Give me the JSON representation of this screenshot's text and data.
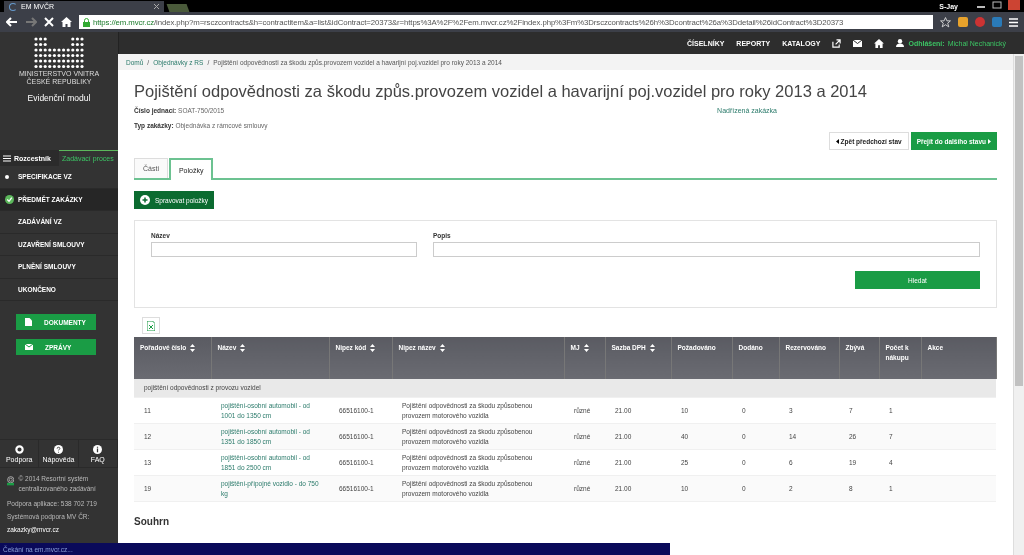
{
  "browser": {
    "tab_title": "EM MVČR",
    "user": "S-Jay",
    "url_host": "https://em.mvcr.cz",
    "url_path": "/index.php?m=rsczcontracts&h=contractitem&a=list&idContract=20373&r=https%3A%2F%2Fem.mvcr.cz%2Findex.php%3Fm%3Drsczcontracts%26h%3Dcontract%26a%3Ddetail%26idContract%3D20373",
    "status": "Čekání na em.mvcr.cz..."
  },
  "topnav": {
    "items": [
      "ČÍSELNÍKY",
      "REPORTY",
      "KATALOGY"
    ],
    "logout_label": "Odhlášení:",
    "user": "Michal Nechanický"
  },
  "sidebar": {
    "logo_lines": [
      "MINISTERSTVO VNITRA",
      "ČESKÉ REPUBLIKY"
    ],
    "module": "Evidenční modul",
    "tabs": [
      {
        "label": "Rozcestník",
        "selected": false
      },
      {
        "label": "Zadávací proces",
        "selected": true
      }
    ],
    "steps": [
      {
        "label": "SPECIFIKACE VZ",
        "visited": true,
        "selected": false
      },
      {
        "label": "PŘEDMĚT ZAKÁZKY",
        "visited": false,
        "selected": true
      },
      {
        "label": "ZADÁVÁNÍ VZ",
        "visited": false,
        "selected": false
      },
      {
        "label": "UZAVŘENÍ SMLOUVY",
        "visited": false,
        "selected": false
      },
      {
        "label": "PLNĚNÍ SMLOUVY",
        "visited": false,
        "selected": false
      },
      {
        "label": "UKONČENO",
        "visited": false,
        "selected": false
      }
    ],
    "buttons": [
      {
        "label": "DOKUMENTY",
        "kind": "documents"
      },
      {
        "label": "ZPRÁVY",
        "kind": "messages"
      }
    ],
    "footer_links": [
      {
        "label": "Podpora",
        "kind": "support"
      },
      {
        "label": "Nápověda",
        "kind": "help"
      },
      {
        "label": "FAQ",
        "kind": "info"
      }
    ],
    "copyright": "© 2014 Resortní systém centralizovaného zadávání",
    "app_support": "Podpora aplikace: 538 702 719",
    "system_support": "Systémová podpora MV ČR:",
    "email": "zakazky@mvcr.cz"
  },
  "breadcrumb_separator": "/",
  "breadcrumb": [
    "Domů",
    "Objednávky z RS",
    "Pojištění odpovědnosti za škodu způs.provozem vozidel a havarijní poj.vozidel pro roky 2013 a 2014"
  ],
  "title": "Pojištění odpovědnosti za škodu způs.provozem vozidel a havarijní poj.vozidel pro roky 2013 a 2014",
  "meta": [
    {
      "label": "Číslo jednací:",
      "value": "SOAT-750/2015"
    },
    {
      "label": "Typ zakázky:",
      "value": "Objednávka z rámcové smlouvy"
    }
  ],
  "parent_link": "Nadřízená zakázka",
  "back_button": "Zpět předchozí stav",
  "next_button": "Přejít do dalšího stavu",
  "tabs": [
    {
      "label": "Části",
      "selected": false
    },
    {
      "label": "Položky",
      "selected": true
    }
  ],
  "manage_button": "Spravovat položky",
  "filters": [
    {
      "label": "Název"
    },
    {
      "label": "Popis"
    }
  ],
  "search_button": "Hledat",
  "table": {
    "columns": [
      {
        "label": "Pořadové číslo",
        "sortable": true
      },
      {
        "label": "Název",
        "sortable": true
      },
      {
        "label": "Nipez kód",
        "sortable": true
      },
      {
        "label": "Nipez název",
        "sortable": true
      },
      {
        "label": "MJ",
        "sortable": true
      },
      {
        "label": "Sazba DPH",
        "sortable": true
      },
      {
        "label": "Požadováno",
        "sortable": false
      },
      {
        "label": "Dodáno",
        "sortable": false
      },
      {
        "label": "Rezervováno",
        "sortable": false
      },
      {
        "label": "Zbývá",
        "sortable": false
      },
      {
        "label": "Počet k nákupu",
        "sortable": false
      },
      {
        "label": "Akce",
        "sortable": false
      }
    ],
    "group": "pojištění odpovědnosti z provozu vozidel",
    "rows": [
      [
        "11",
        "pojištění-osobní automobil - od 1001 do 1350 cm",
        "66516100-1",
        "Pojištění odpovědnosti za škodu způsobenou provozem motorového vozidla",
        "různé",
        "21.00",
        "10",
        "0",
        "3",
        "7",
        "1"
      ],
      [
        "12",
        "pojištění-osobní automobil - od 1351 do 1850 cm",
        "66516100-1",
        "Pojištění odpovědnosti za škodu způsobenou provozem motorového vozidla",
        "různé",
        "21.00",
        "40",
        "0",
        "14",
        "26",
        "7"
      ],
      [
        "13",
        "pojištění-osobní automobil - od 1851 do 2500 cm",
        "66516100-1",
        "Pojištění odpovědnosti za škodu způsobenou provozem motorového vozidla",
        "různé",
        "21.00",
        "25",
        "0",
        "6",
        "19",
        "4"
      ],
      [
        "19",
        "pojištění-přípojné vozidlo - do 750 kg",
        "66516100-1",
        "Pojištění odpovědnosti za škodu způsobenou provozem motorového vozidla",
        "různé",
        "21.00",
        "10",
        "0",
        "2",
        "8",
        "1"
      ]
    ]
  },
  "summary_heading": "Souhrn"
}
